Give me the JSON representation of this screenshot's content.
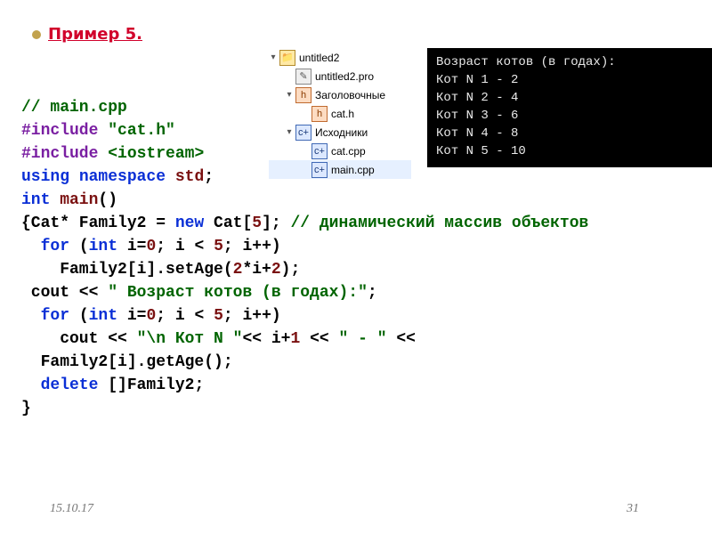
{
  "title": "Пример 5.",
  "code": {
    "l1": "// main.cpp",
    "l2a": "#include",
    "l2b": " \"cat.h\"",
    "l3a": "#include",
    "l3b": " <iostream>",
    "l4a": "using",
    "l4b": " namespace",
    "l4c": " std",
    "l4d": ";",
    "l5a": "int",
    "l5b": " main",
    "l5c": "()",
    "l6a": "{Cat* Family2 = ",
    "l6b": "new",
    "l6c": " Cat[",
    "l6d": "5",
    "l6e": "]; ",
    "l6f": "// динамический массив объектов",
    "l7a": "  for",
    "l7b": " (",
    "l7c": "int",
    "l7d": " i=",
    "l7e": "0",
    "l7f": "; i < ",
    "l7g": "5",
    "l7h": "; i++)",
    "l8": "    Family2[i].setAge(",
    "l8b": "2",
    "l8c": "*i+",
    "l8d": "2",
    "l8e": ");",
    "l9a": " cout << ",
    "l9b": "\" Возраст котов (в годах):\"",
    "l9c": ";",
    "l10a": "  for",
    "l10b": " (",
    "l10c": "int",
    "l10d": " i=",
    "l10e": "0",
    "l10f": "; i < ",
    "l10g": "5",
    "l10h": "; i++)",
    "l11a": "    cout << ",
    "l11b": "\"\\n Кот N \"",
    "l11c": "<< i+",
    "l11d": "1",
    "l11e": " << ",
    "l11f": "\" - \"",
    "l11g": " <<",
    "l12": "  Family2[i].getAge();",
    "l13a": "  delete",
    "l13b": " []Family2;",
    "l14": "}"
  },
  "tree": {
    "root": "untitled2",
    "pro": "untitled2.pro",
    "headers": "Заголовочные",
    "cat_h": "cat.h",
    "sources": "Исходники",
    "cat_cpp": "cat.cpp",
    "main_cpp": "main.cpp"
  },
  "console": "Возраст котов (в годах):\nКот N 1 - 2\nКот N 2 - 4\nКот N 3 - 6\nКот N 4 - 8\nКот N 5 - 10",
  "footer": {
    "date": "15.10.17",
    "page": "31"
  },
  "twist": {
    "open": "▾",
    "closed": "▸"
  }
}
